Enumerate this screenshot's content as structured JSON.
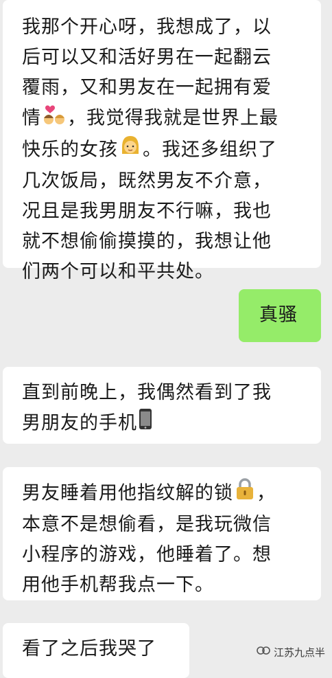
{
  "messages": [
    {
      "side": "left",
      "lines": [
        "我那个开心呀，我想成了，以",
        "后可以又和活好男在一起翻云",
        "覆雨，又和男友在一起拥有爱",
        [
          "情",
          "kiss-icon",
          "，我觉得我就是世界上最"
        ],
        [
          "快乐的女孩",
          "girl-icon",
          "。我还多组织了"
        ],
        "几次饭局，既然男友不介意，",
        "况且是我男朋友不行嘛，我也",
        "就不想偷偷摸摸的，我想让他",
        "们两个可以和平共处。"
      ]
    },
    {
      "side": "right",
      "lines": [
        "真骚"
      ]
    },
    {
      "side": "left",
      "lines": [
        "直到前晚上，我偶然看到了我",
        [
          "男朋友的手机",
          "phone-icon",
          ""
        ]
      ]
    },
    {
      "side": "left",
      "lines": [
        [
          "男友睡着用他指纹解的锁",
          "lock-icon",
          "，"
        ],
        "本意不是想偷看，是我玩微信",
        "小程序的游戏，他睡着了。想",
        "用他手机帮我点一下。"
      ]
    },
    {
      "side": "left",
      "lines": [
        "看了之后我哭了"
      ]
    }
  ],
  "watermark": {
    "icon": "wechat-official-account-icon",
    "text": "江苏九点半"
  }
}
